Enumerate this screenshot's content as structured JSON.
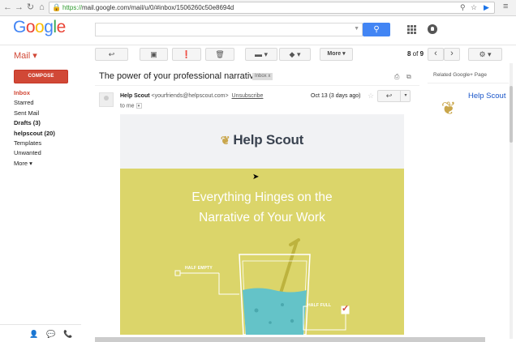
{
  "browser": {
    "url_scheme": "https://",
    "url_rest": "mail.google.com/mail/u/0/#inbox/1506260c50e8694d",
    "back_glyph": "←",
    "forward_glyph": "→",
    "reload_glyph": "↻",
    "home_glyph": "⌂",
    "lock_glyph": "🔒",
    "zoom_glyph": "⚲",
    "star_glyph": "☆",
    "ext_glyph": "▶",
    "menu_glyph": "≡"
  },
  "gmail": {
    "logo_letters": [
      "G",
      "o",
      "o",
      "g",
      "l",
      "e"
    ],
    "logo_colors": [
      "#4285f4",
      "#ea4335",
      "#fbbc05",
      "#4285f4",
      "#34a853",
      "#ea4335"
    ],
    "search": {
      "placeholder": "",
      "button_glyph": "⚲"
    },
    "mail_label": "Mail ▾",
    "toolbar": {
      "back_glyph": "↩",
      "archive_glyph": "▣",
      "spam_glyph": "❗",
      "delete_glyph": "🗑",
      "folder_glyph": "▬ ▾",
      "label_glyph": "◆ ▾",
      "more_label": "More ▾",
      "pager_current": "8",
      "pager_sep": " of ",
      "pager_total": "9",
      "prev_glyph": "‹",
      "next_glyph": "›",
      "settings_glyph": "⚙ ▾"
    },
    "compose_label": "COMPOSE",
    "nav": [
      {
        "label": "Inbox",
        "style": "active"
      },
      {
        "label": "Starred",
        "style": ""
      },
      {
        "label": "Sent Mail",
        "style": ""
      },
      {
        "label": "Drafts (3)",
        "style": "bold"
      },
      {
        "label": "helpscout (20)",
        "style": "bold"
      },
      {
        "label": "Templates",
        "style": ""
      },
      {
        "label": "Unwanted",
        "style": ""
      },
      {
        "label": "More ▾",
        "style": ""
      }
    ],
    "footer_icons": {
      "person": "👤",
      "hangout": "💬",
      "phone": "📞"
    }
  },
  "email": {
    "subject": "The power of your professional narrative",
    "label_chip": "Inbox x",
    "print_glyph": "⎙",
    "newwin_glyph": "⧉",
    "sender_name": "Help Scout",
    "sender_email": "<yourfriends@helpscout.com>",
    "unsubscribe": "Unsubscribe",
    "to": "to me",
    "to_caret": "▾",
    "date": "Oct 13 (3 days ago)",
    "star_glyph": "☆",
    "reply_glyph": "↩",
    "more_caret": "▾",
    "body": {
      "brand": "Help Scout",
      "wreath_glyph": "❦",
      "headline_1": "Everything Hinges on the",
      "headline_2": "Narrative of Your Work",
      "label_half_empty": "HALF EMPTY",
      "label_half_full": "HALF FULL",
      "check_glyph": "✓"
    }
  },
  "right_panel": {
    "title": "Related Google+ Page",
    "page_name": "Help Scout",
    "logo_glyph": "❦"
  },
  "colors": {
    "compose": "#d14836",
    "search_button": "#4285f4",
    "hero_bg": "#dbd56a",
    "water": "#64c3c8"
  }
}
